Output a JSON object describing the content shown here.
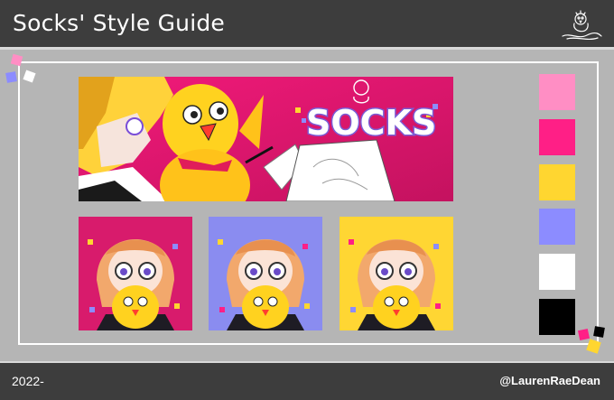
{
  "header": {
    "title": "Socks' Style Guide",
    "logo_icon": "chick-signature-logo"
  },
  "banner": {
    "brand_text": "SOCKS",
    "background": "#e8197a"
  },
  "avatars": [
    {
      "background": "#d81b6c"
    },
    {
      "background": "#8a8cf0"
    },
    {
      "background": "#ffd633"
    }
  ],
  "palette": [
    "#ff8ec4",
    "#ff1f86",
    "#ffd630",
    "#8c8cff",
    "#ffffff",
    "#000000"
  ],
  "footer": {
    "year": "2022-",
    "handle": "@LaurenRaeDean"
  }
}
